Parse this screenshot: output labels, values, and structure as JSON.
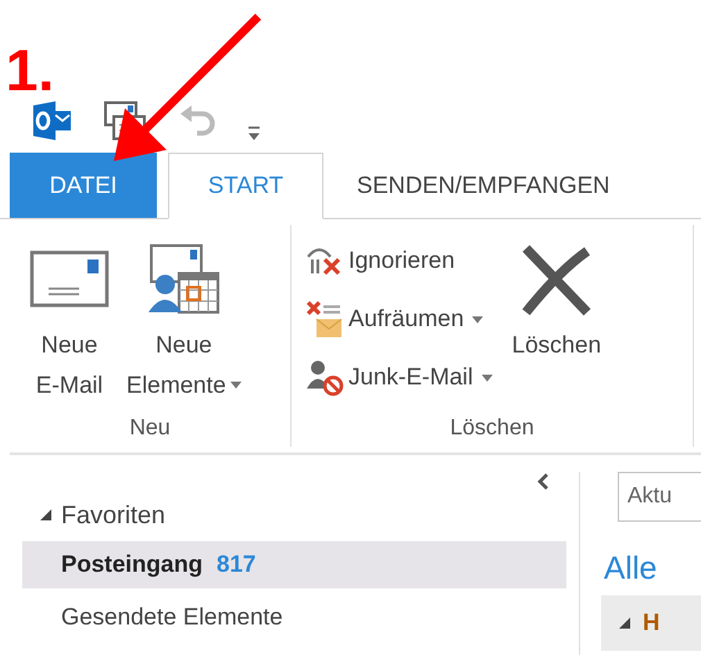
{
  "annotation": {
    "label": "1."
  },
  "tabs": [
    {
      "label": "DATEI",
      "kind": "file",
      "selected": false
    },
    {
      "label": "START",
      "kind": "tab",
      "selected": true
    },
    {
      "label": "SENDEN/EMPFANGEN",
      "kind": "tab",
      "selected": false
    }
  ],
  "ribbon": {
    "groups": [
      {
        "label": "Neu",
        "buttons": [
          {
            "kind": "large",
            "lines": [
              "Neue",
              "E-Mail"
            ],
            "dropdown": false
          },
          {
            "kind": "large",
            "lines": [
              "Neue",
              "Elemente"
            ],
            "dropdown": true
          }
        ]
      },
      {
        "label": "Löschen",
        "buttons": [
          {
            "kind": "small",
            "lines": [
              "Ignorieren"
            ],
            "dropdown": false
          },
          {
            "kind": "small",
            "lines": [
              "Aufräumen"
            ],
            "dropdown": true
          },
          {
            "kind": "small",
            "lines": [
              "Junk-E-Mail"
            ],
            "dropdown": true
          },
          {
            "kind": "large",
            "lines": [
              "Löschen"
            ],
            "dropdown": false
          }
        ]
      }
    ]
  },
  "folders": {
    "header": "Favoriten",
    "expanded": true,
    "items": [
      {
        "label": "Posteingang",
        "count": "817",
        "selected": true
      },
      {
        "label": "Gesendete Elemente",
        "selected": false
      }
    ]
  },
  "mail_list": {
    "search": {
      "placeholder": "Aktu"
    },
    "filter": "Alle",
    "group_header": {
      "label": "H",
      "expanded": true
    }
  }
}
